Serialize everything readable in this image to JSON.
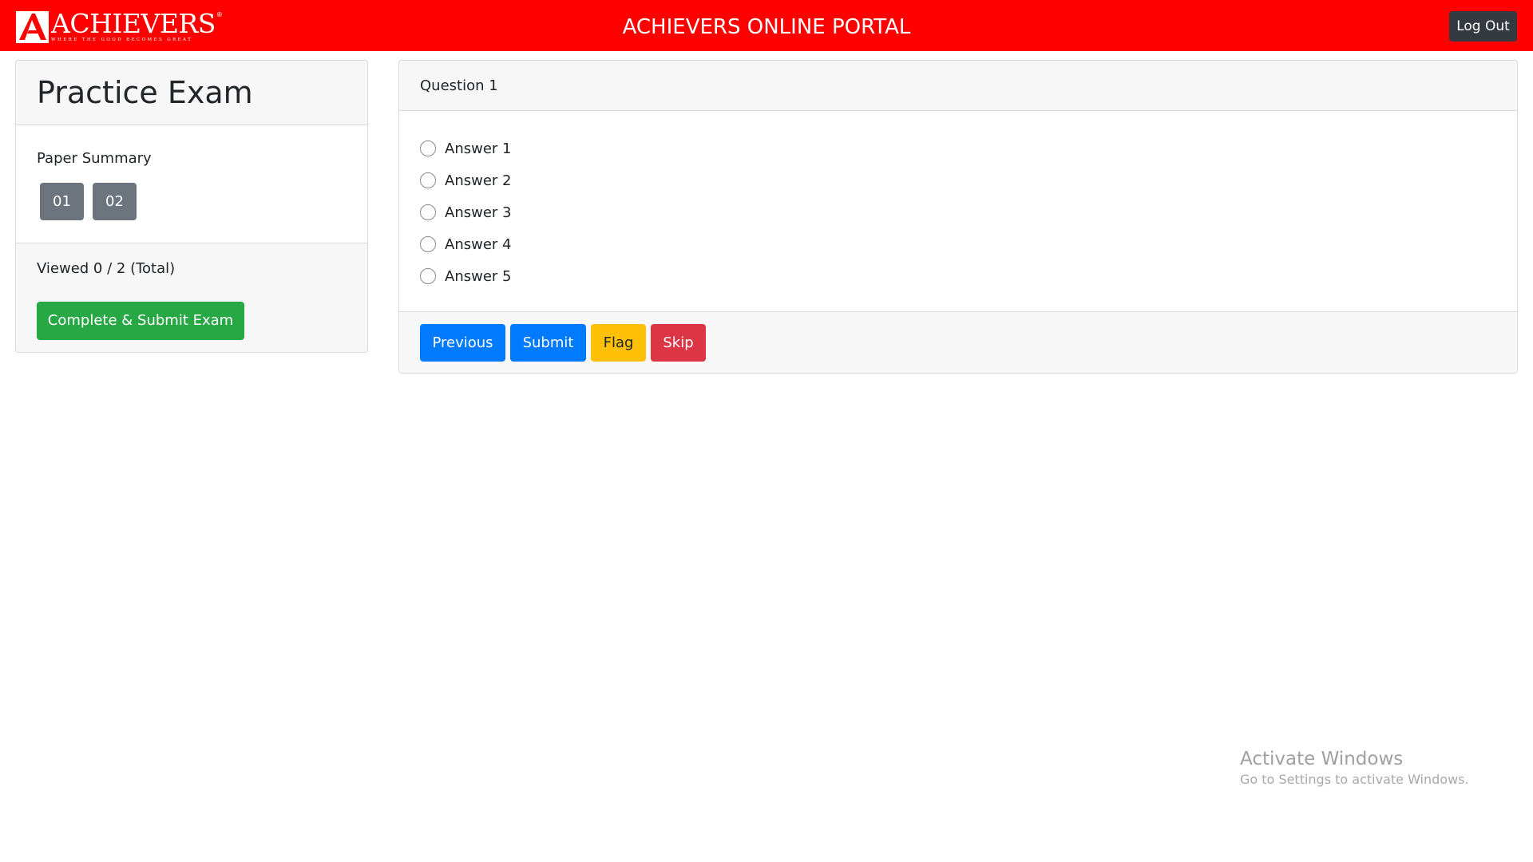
{
  "header": {
    "logo_text": "ACHIEVERS",
    "logo_tagline": "WHERE THE GOOD BECOMES GREAT",
    "logo_reg": "®",
    "title": "ACHIEVERS ONLINE PORTAL",
    "logout_label": "Log Out",
    "brand_color": "#ff0000"
  },
  "sidebar": {
    "exam_title": "Practice Exam",
    "summary_label": "Paper Summary",
    "papers": [
      "01",
      "02"
    ],
    "viewed_text": "Viewed 0 / 2 (Total)",
    "submit_label": "Complete & Submit Exam"
  },
  "question": {
    "title": "Question 1",
    "answers": [
      "Answer 1",
      "Answer 2",
      "Answer 3",
      "Answer 4",
      "Answer 5"
    ],
    "actions": {
      "previous": "Previous",
      "submit": "Submit",
      "flag": "Flag",
      "skip": "Skip"
    }
  },
  "watermark": {
    "title": "Activate Windows",
    "subtitle": "Go to Settings to activate Windows."
  }
}
